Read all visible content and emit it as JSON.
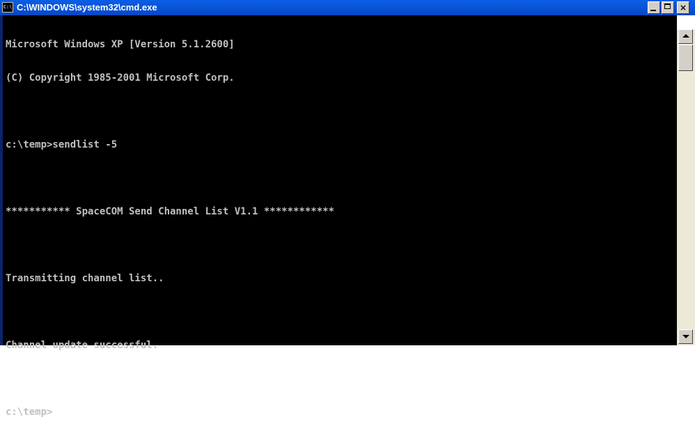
{
  "window": {
    "title": "C:\\WINDOWS\\system32\\cmd.exe",
    "icon": "cmd-console-icon",
    "icon_text": "C:\\"
  },
  "controls": {
    "minimize_icon": "minimize-icon",
    "maximize_icon": "maximize-icon",
    "close_label": "×"
  },
  "console": {
    "background": "#000000",
    "foreground": "#c0c0c0",
    "lines": [
      "Microsoft Windows XP [Version 5.1.2600]",
      "(C) Copyright 1985-2001 Microsoft Corp.",
      "",
      "c:\\temp>sendlist -5",
      "",
      "*********** SpaceCOM Send Channel List V1.1 ************",
      "",
      "Transmitting channel list..",
      "",
      "Channel update successful.",
      "",
      "c:\\temp>"
    ]
  },
  "colors": {
    "titlebar": "#0a56d8",
    "title_text": "#ffffff",
    "button_face": "#d4d0c8"
  }
}
